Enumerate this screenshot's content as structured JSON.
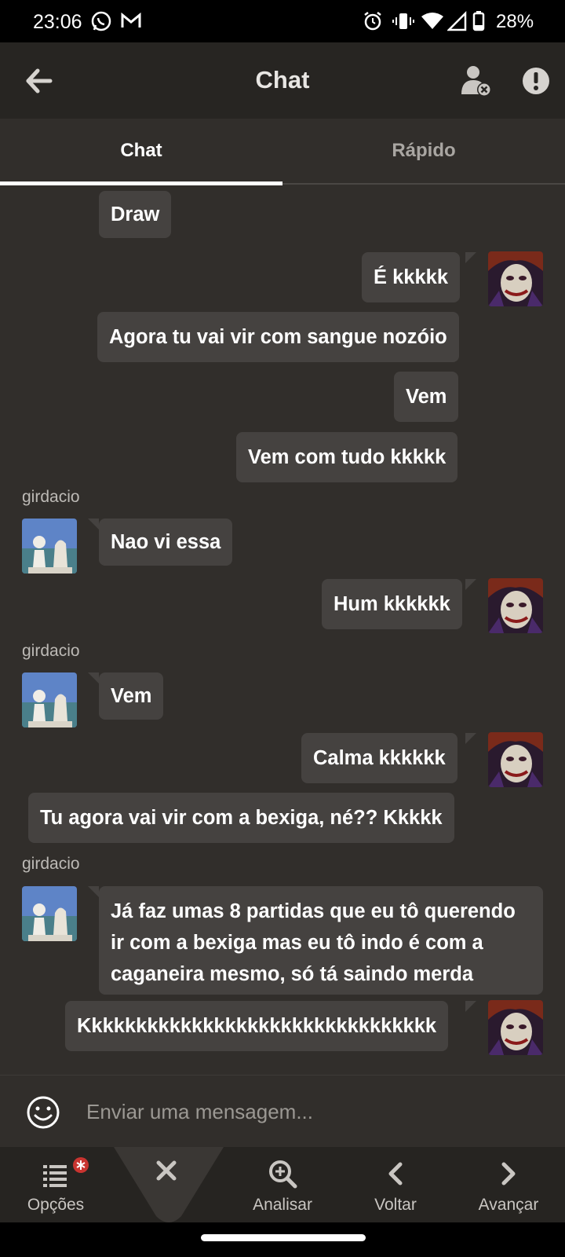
{
  "status_bar": {
    "time": "23:06",
    "battery": "28%"
  },
  "app_bar": {
    "title": "Chat"
  },
  "tabs": [
    {
      "label": "Chat",
      "active": true
    },
    {
      "label": "Rápido",
      "active": false
    }
  ],
  "messages": [
    {
      "side": "left",
      "text": "Draw"
    },
    {
      "side": "right",
      "text": "É kkkkk"
    },
    {
      "side": "right",
      "text": "Agora tu vai vir com sangue nozóio"
    },
    {
      "side": "right",
      "text": "Vem"
    },
    {
      "side": "right",
      "text": "Vem com tudo kkkkk"
    },
    {
      "side": "left",
      "user": "girdacio",
      "text": "Nao vi essa"
    },
    {
      "side": "right",
      "text": "Hum kkkkkk"
    },
    {
      "side": "left",
      "user": "girdacio",
      "text": "Vem"
    },
    {
      "side": "right",
      "text": "Calma kkkkkk"
    },
    {
      "side": "right",
      "text": "Tu agora vai vir com a bexiga, né?? Kkkkk"
    },
    {
      "side": "left",
      "user": "girdacio",
      "text": "Já faz umas 8 partidas que eu tô querendo ir com a bexiga mas eu tô indo é com a caganeira mesmo, só tá saindo merda"
    },
    {
      "side": "right",
      "text": "Kkkkkkkkkkkkkkkkkkkkkkkkkkkkkkkk"
    }
  ],
  "composer": {
    "placeholder": "Enviar uma mensagem..."
  },
  "bottom_nav": {
    "options": "Opções",
    "analyze": "Analisar",
    "back": "Voltar",
    "forward": "Avançar"
  },
  "colors": {
    "background": "#312e2b",
    "bubble": "#454240",
    "appbar": "#272522",
    "badge": "#c93430"
  }
}
